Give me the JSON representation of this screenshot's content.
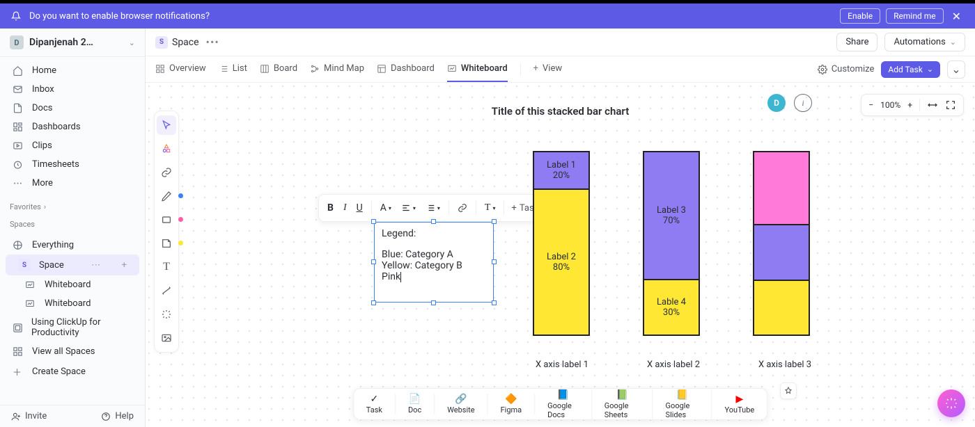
{
  "notification": {
    "text": "Do you want to enable browser notifications?",
    "enable": "Enable",
    "remind": "Remind me"
  },
  "workspace": {
    "initial": "D",
    "name": "Dipanjenah 2…"
  },
  "sidebar": {
    "nav": [
      "Home",
      "Inbox",
      "Docs",
      "Dashboards",
      "Clips",
      "Timesheets",
      "More"
    ],
    "favorites": "Favorites",
    "spaces": "Spaces",
    "everything": "Everything",
    "space": "Space",
    "whiteboard1": "Whiteboard",
    "whiteboard2": "Whiteboard",
    "using": "Using ClickUp for Productivity",
    "viewall": "View all Spaces",
    "create": "Create Space",
    "invite": "Invite",
    "help": "Help"
  },
  "header": {
    "space": "Space",
    "share": "Share",
    "automations": "Automations"
  },
  "tabs": {
    "overview": "Overview",
    "list": "List",
    "board": "Board",
    "mindmap": "Mind Map",
    "dashboard": "Dashboard",
    "whiteboard": "Whiteboard",
    "view": "View",
    "customize": "Customize",
    "addtask": "Add Task"
  },
  "zoom": {
    "avatar": "D",
    "level": "100%"
  },
  "texttoolbar": {
    "task": "Task"
  },
  "legend": {
    "title": "Legend:",
    "l1": "Blue: Category A",
    "l2": "Yellow: Category B",
    "l3": "Pink"
  },
  "bottombar": [
    "Task",
    "Doc",
    "Website",
    "Figma",
    "Google Docs",
    "Google Sheets",
    "Google Slides",
    "YouTube"
  ],
  "chart_data": {
    "type": "bar",
    "title": "Title of this stacked bar chart",
    "categories": [
      "X axis label 1",
      "X axis label 2",
      "X axis label 3"
    ],
    "series": [
      {
        "name": "Category A",
        "color": "#8f7bf2",
        "labels": [
          "Label 1",
          "Label 3",
          ""
        ],
        "values": [
          20,
          70,
          30
        ]
      },
      {
        "name": "Category B",
        "color": "#ffe733",
        "labels": [
          "Label 2",
          "Lable 4",
          ""
        ],
        "values": [
          80,
          30,
          30
        ]
      },
      {
        "name": "Pink",
        "color": "#ff7ad9",
        "labels": [
          "",
          "",
          ""
        ],
        "values": [
          0,
          0,
          40
        ]
      }
    ],
    "bars": [
      [
        {
          "label": "Label 1",
          "pct": "20%",
          "h": 20,
          "color": "#8f7bf2"
        },
        {
          "label": "Label 2",
          "pct": "80%",
          "h": 80,
          "color": "#ffe733"
        }
      ],
      [
        {
          "label": "Label 3",
          "pct": "70%",
          "h": 70,
          "color": "#8f7bf2"
        },
        {
          "label": "Lable 4",
          "pct": "30%",
          "h": 30,
          "color": "#ffe733"
        }
      ],
      [
        {
          "label": "",
          "pct": "",
          "h": 40,
          "color": "#ff7ad9"
        },
        {
          "label": "",
          "pct": "",
          "h": 30,
          "color": "#8f7bf2"
        },
        {
          "label": "",
          "pct": "",
          "h": 30,
          "color": "#ffe733"
        }
      ]
    ]
  }
}
